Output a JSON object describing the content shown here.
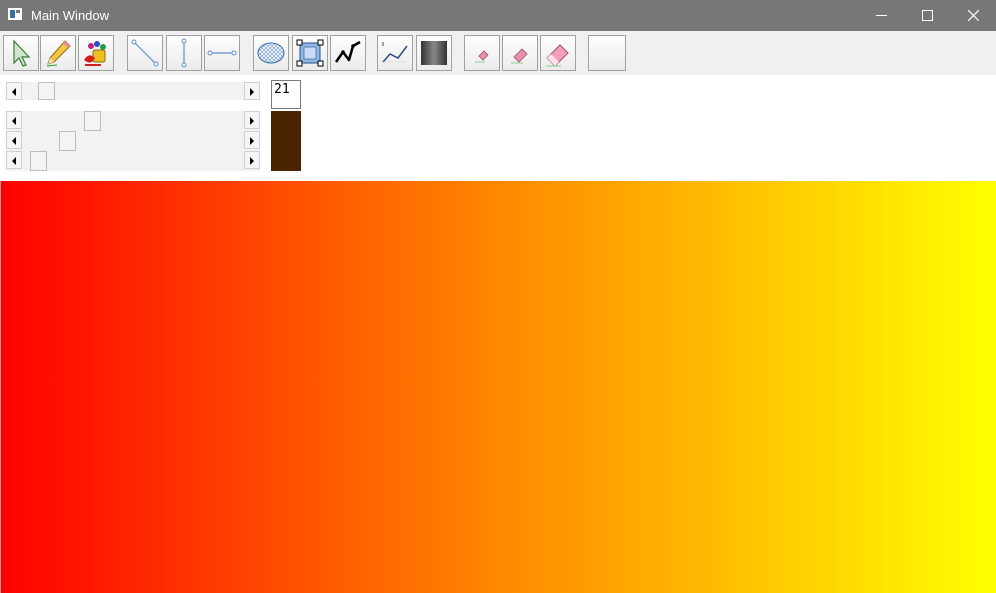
{
  "window": {
    "title": "Main Window",
    "icon": "window-app-icon",
    "buttons": [
      "minimize-icon",
      "maximize-icon",
      "close-icon"
    ],
    "titlebar_color": "#777777"
  },
  "toolbar": {
    "tools": [
      {
        "name": "select-tool",
        "icon": "arrow-cursor-icon"
      },
      {
        "name": "pencil-tool",
        "icon": "pencil-icon"
      },
      {
        "name": "paint-tool",
        "icon": "paint-palette-icon"
      },
      {
        "name": "diagonal-line-tool",
        "icon": "diagonal-line-icon"
      },
      {
        "name": "vertical-line-tool",
        "icon": "vertical-line-icon"
      },
      {
        "name": "horizontal-line-tool",
        "icon": "horizontal-line-icon"
      },
      {
        "name": "lasso-tool",
        "icon": "mesh-ellipse-icon"
      },
      {
        "name": "transform-tool",
        "icon": "bounding-box-icon"
      },
      {
        "name": "bezier-tool",
        "icon": "bezier-curve-icon"
      },
      {
        "name": "curve-tool",
        "icon": "polyline-curve-icon"
      },
      {
        "name": "gradient-tool",
        "icon": "gray-gradient-icon"
      },
      {
        "name": "small-eraser-tool",
        "icon": "small-eraser-icon"
      },
      {
        "name": "medium-eraser-tool",
        "icon": "medium-eraser-icon"
      },
      {
        "name": "large-eraser-tool",
        "icon": "large-eraser-icon"
      },
      {
        "name": "blank-tool",
        "icon": "blank-icon"
      }
    ]
  },
  "controls": {
    "size_value": "21",
    "size_slider_fraction": 0.08,
    "red_slider_fraction": 0.3,
    "green_slider_fraction": 0.18,
    "blue_slider_fraction": 0.04,
    "swatch_color": "#4a2300"
  },
  "canvas": {
    "gradient_start": "#ff0000",
    "gradient_mid": "#ff8800",
    "gradient_end": "#ffff00"
  }
}
